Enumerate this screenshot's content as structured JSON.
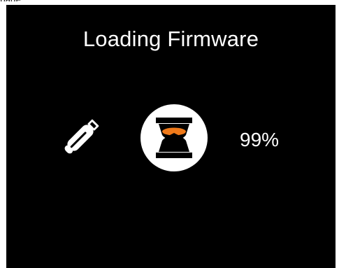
{
  "top_fragment_text": "page",
  "screen": {
    "title": "Loading Firmware",
    "progress_text": "99%",
    "progress_value_percent": 99
  },
  "icons": {
    "usb": "usb-drive-icon",
    "progress": "hourglass-icon"
  },
  "colors": {
    "background": "#000000",
    "foreground": "#ffffff",
    "accent": "#f07a1a"
  }
}
